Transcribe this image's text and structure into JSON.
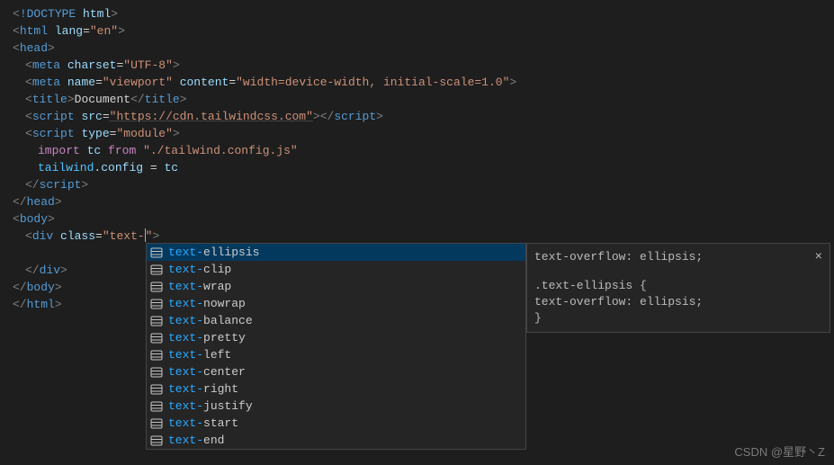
{
  "code": {
    "doctype": "!DOCTYPE",
    "doctype_kw": "html",
    "html": "html",
    "lang_attr": "lang",
    "lang_val": "\"en\"",
    "head": "head",
    "meta": "meta",
    "charset_attr": "charset",
    "charset_val": "\"UTF-8\"",
    "name_attr": "name",
    "viewport_val": "\"viewport\"",
    "content_attr": "content",
    "content_val": "\"width=device-width, initial-scale=1.0\"",
    "title": "title",
    "title_text": "Document",
    "script": "script",
    "src_attr": "src",
    "src_val": "\"https://cdn.tailwindcss.com\"",
    "type_attr": "type",
    "module_val": "\"module\"",
    "import_kw": "import",
    "import_name": "tc",
    "from_kw": "from",
    "import_path": "\"./tailwind.config.js\"",
    "tailwind_obj": "tailwind",
    "config_prop": "config",
    "eq": " = ",
    "config_val": "tc",
    "body": "body",
    "div": "div",
    "class_attr": "class",
    "class_val_prefix": "\"text-",
    "class_val_suffix": "\""
  },
  "suggestions": [
    {
      "match": "text-",
      "rest": "ellipsis",
      "selected": true
    },
    {
      "match": "text-",
      "rest": "clip",
      "selected": false
    },
    {
      "match": "text-",
      "rest": "wrap",
      "selected": false
    },
    {
      "match": "text-",
      "rest": "nowrap",
      "selected": false
    },
    {
      "match": "text-",
      "rest": "balance",
      "selected": false
    },
    {
      "match": "text-",
      "rest": "pretty",
      "selected": false
    },
    {
      "match": "text-",
      "rest": "left",
      "selected": false
    },
    {
      "match": "text-",
      "rest": "center",
      "selected": false
    },
    {
      "match": "text-",
      "rest": "right",
      "selected": false
    },
    {
      "match": "text-",
      "rest": "justify",
      "selected": false
    },
    {
      "match": "text-",
      "rest": "start",
      "selected": false
    },
    {
      "match": "text-",
      "rest": "end",
      "selected": false
    }
  ],
  "doc": {
    "preview": "text-overflow: ellipsis;",
    "selector": ".text-ellipsis {",
    "rule_indent": "  ",
    "rule": "text-overflow: ellipsis;",
    "close": "}"
  },
  "watermark": "CSDN @星野丶Z"
}
